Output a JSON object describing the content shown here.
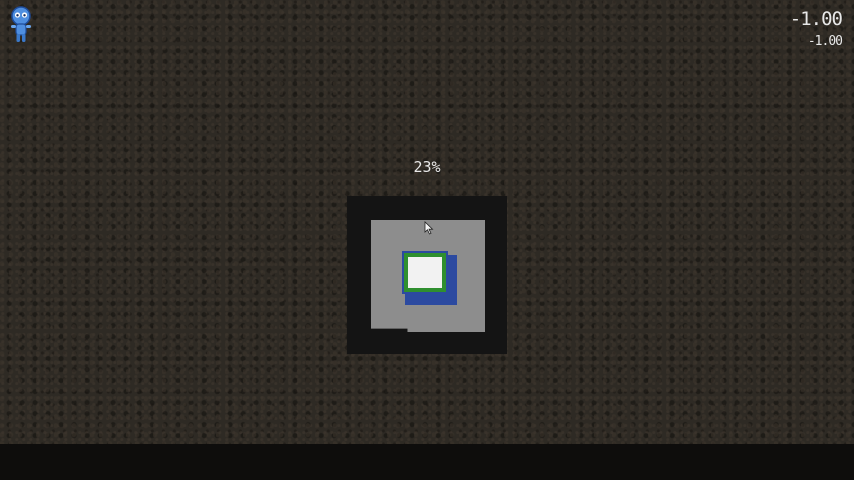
{
  "hud": {
    "time_main": "-1.00",
    "time_sub": "-1.00",
    "character_icon": "alien-character-icon"
  },
  "loading": {
    "progress_label": "23%",
    "progress": 0.23
  },
  "minimap": {
    "player_marker_color": "#2f8f2f",
    "player_border_color": "#2c4aa0",
    "floor_color": "#8d8d8d",
    "frame_color": "#141414"
  },
  "colors": {
    "background": "#2e2a24",
    "bottom_bar": "#0e0d0c",
    "text": "#e8e8e8"
  }
}
